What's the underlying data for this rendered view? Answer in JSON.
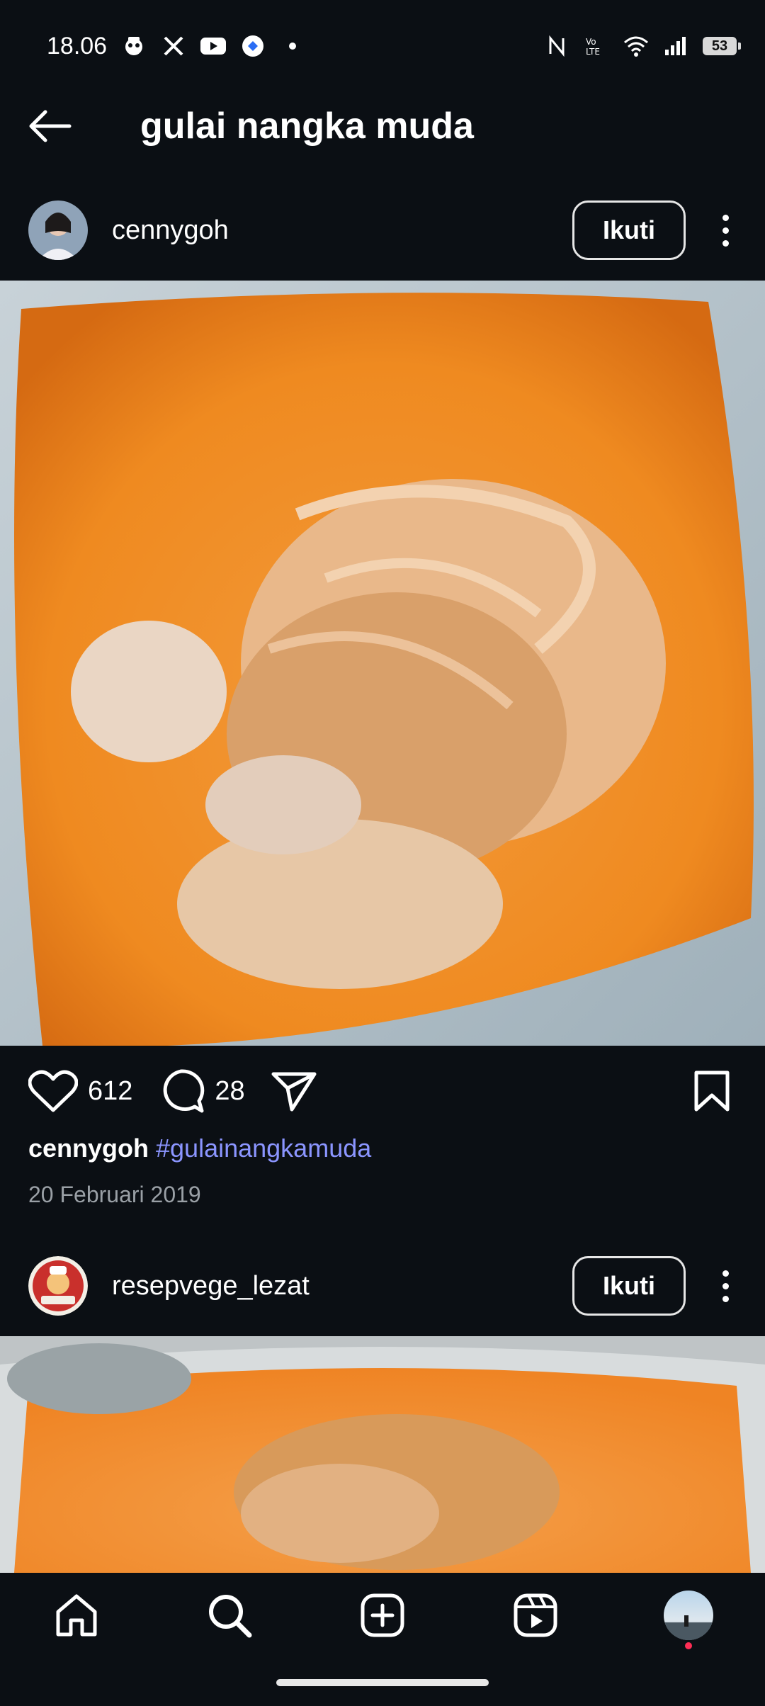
{
  "status_bar": {
    "time": "18.06",
    "battery": "53",
    "icons": [
      "app-icon",
      "x-icon",
      "youtube-icon",
      "app-icon-2",
      "dot-icon",
      "nfc-icon",
      "volte-icon",
      "wifi-icon",
      "signal-icon"
    ]
  },
  "header": {
    "title": "gulai nangka muda",
    "back_icon": "arrow-left-icon"
  },
  "posts": [
    {
      "username": "cennygoh",
      "follow_label": "Ikuti",
      "likes": "612",
      "comments": "28",
      "caption_user": "cennygoh",
      "caption_tag": "#gulainangkamuda",
      "date": "20 Februari 2019"
    },
    {
      "username": "resepvege_lezat",
      "follow_label": "Ikuti"
    }
  ],
  "bottom_nav": {
    "items": [
      "home-icon",
      "search-icon",
      "create-icon",
      "reels-icon",
      "profile-avatar"
    ]
  },
  "colors": {
    "background": "#0b0f14",
    "hashtag": "#8b95ff",
    "secondary_text": "#9aa0a6",
    "notification_dot": "#ff2d55"
  }
}
